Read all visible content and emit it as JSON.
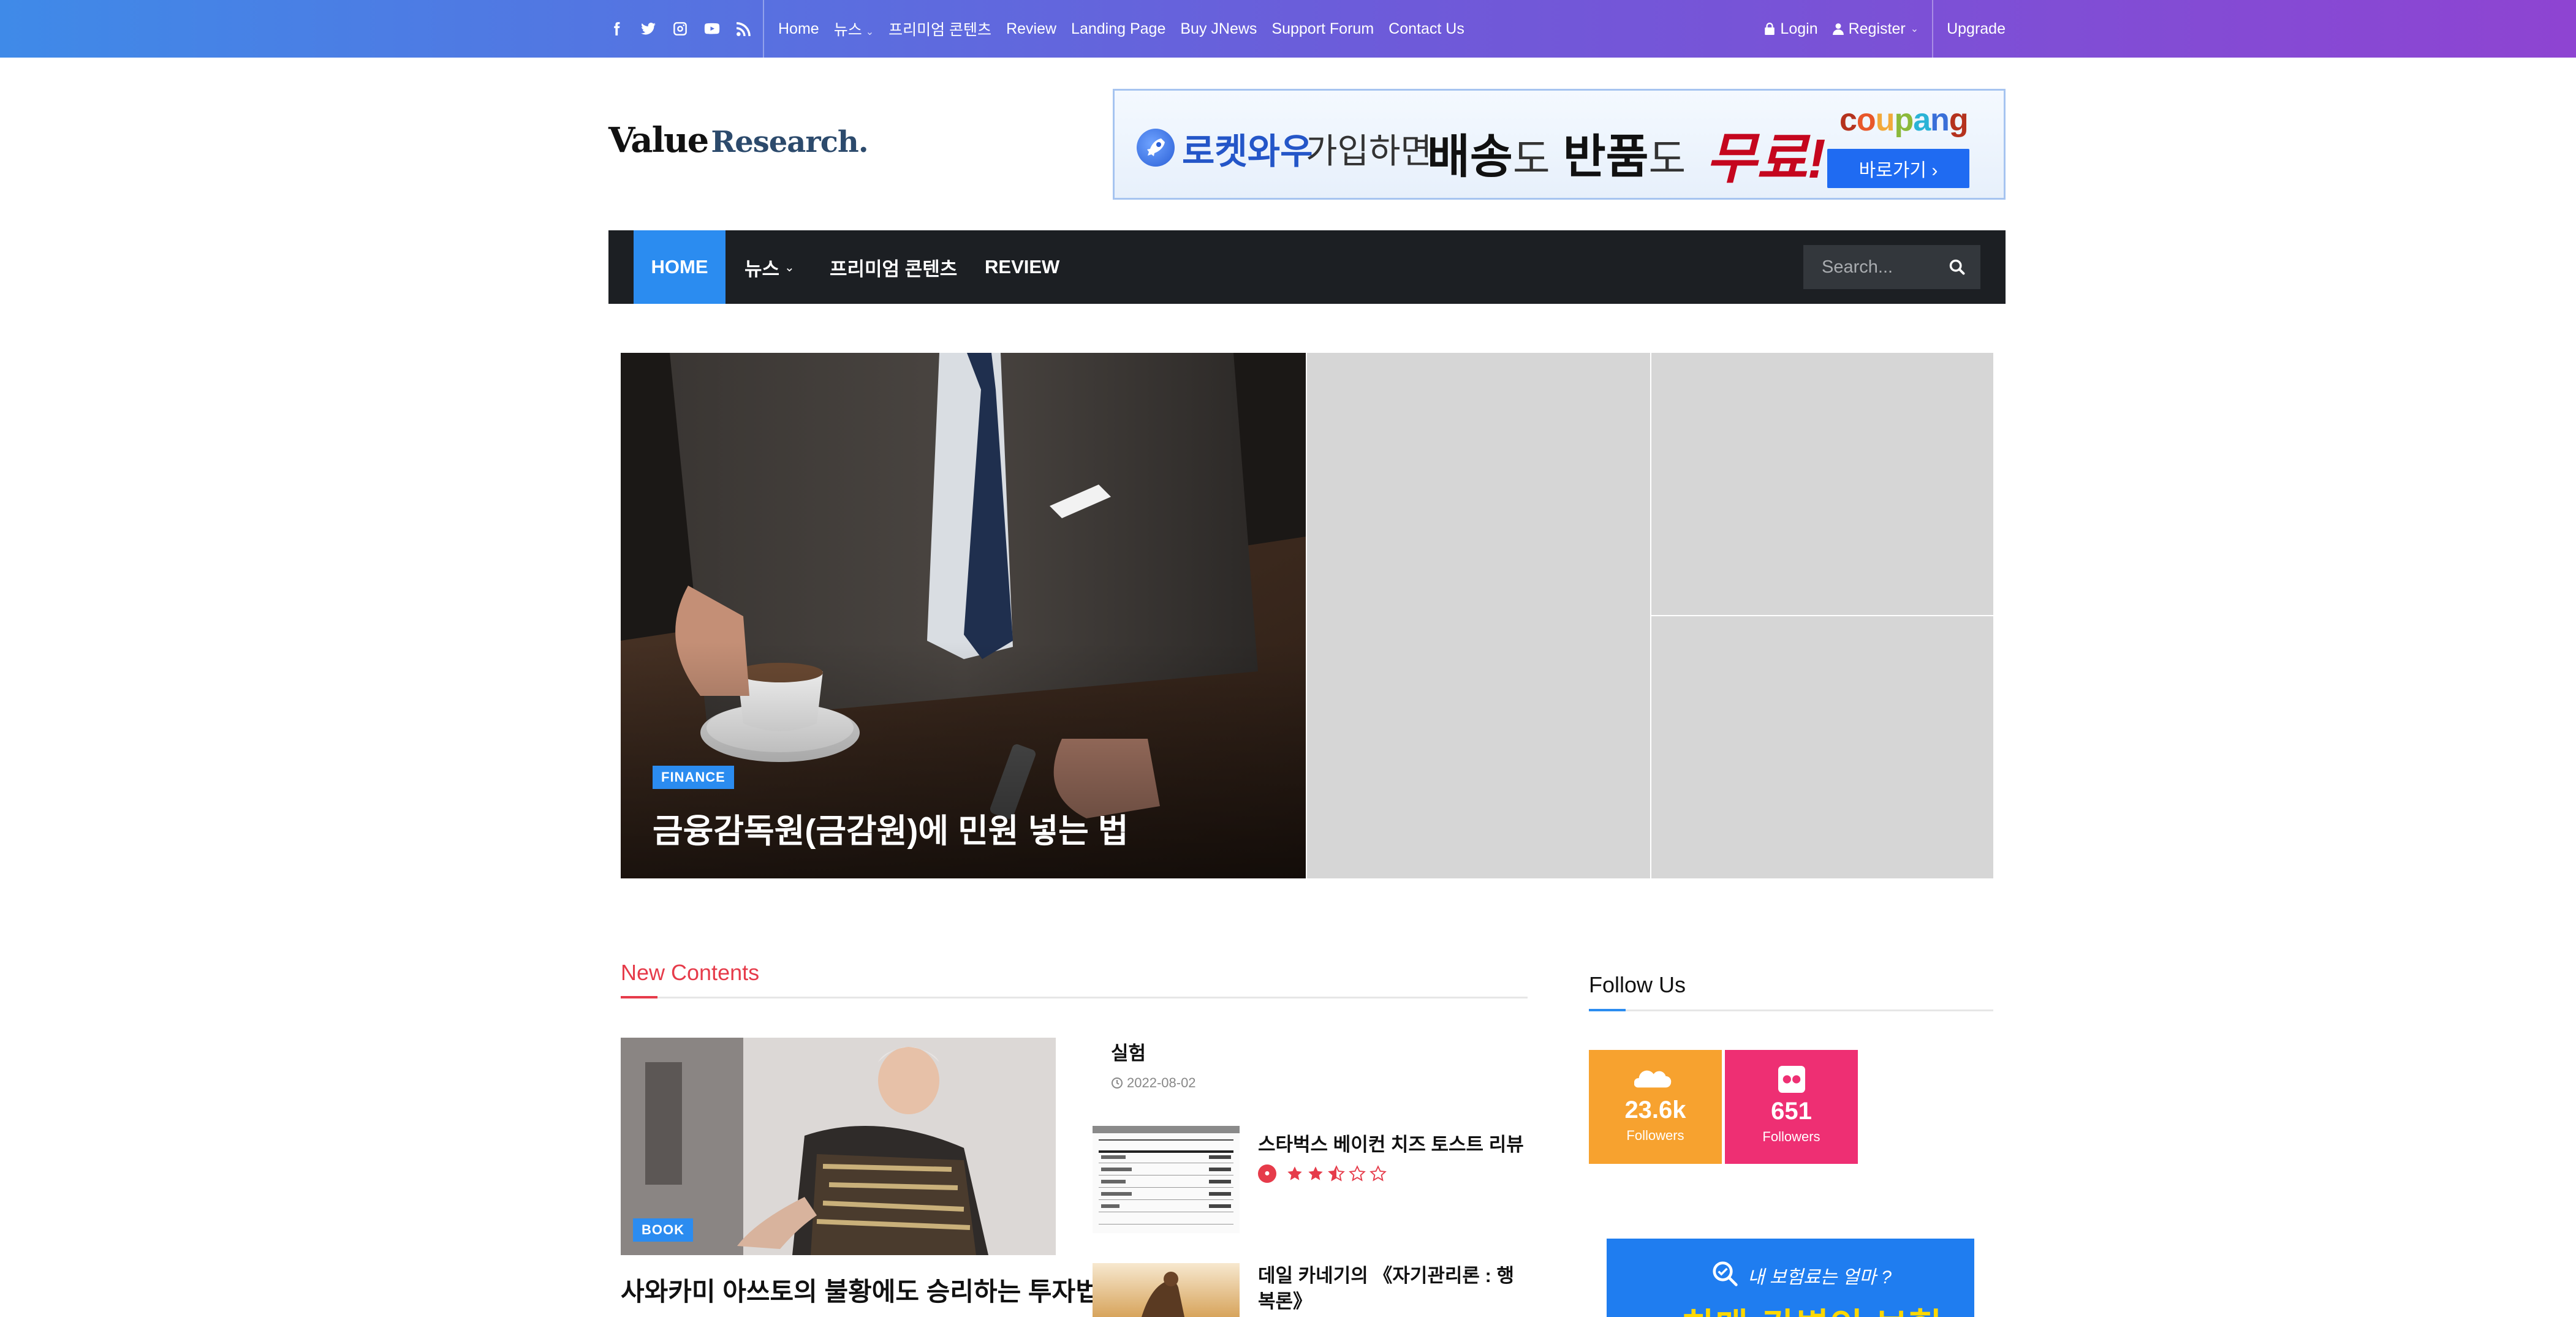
{
  "topbar": {
    "social": [
      "facebook-icon",
      "twitter-icon",
      "instagram-icon",
      "youtube-icon",
      "rss-icon"
    ],
    "nav": [
      "Home",
      "뉴스",
      "프리미엄 콘텐츠",
      "Review",
      "Landing Page",
      "Buy JNews",
      "Support Forum",
      "Contact Us"
    ],
    "login": "Login",
    "register": "Register",
    "upgrade": "Upgrade"
  },
  "header": {
    "logo_word1": "Value",
    "logo_word2": "Research."
  },
  "ad_banner": {
    "part1": "로켓와우",
    "part2": "가입하면",
    "part3a": "배송",
    "part3b": "도",
    "part3c": "반품",
    "part3d": "도",
    "part4": "무료!",
    "brand": [
      "c",
      "o",
      "u",
      "p",
      "a",
      "n",
      "g"
    ],
    "button": "바로가기 ›"
  },
  "mainnav": {
    "home": "HOME",
    "news": "뉴스",
    "premium": "프리미엄 콘텐츠",
    "review": "REVIEW",
    "search_placeholder": "Search..."
  },
  "hero": {
    "category": "FINANCE",
    "title": "금융감독원(금감원)에 민원 넣는 법"
  },
  "new_contents": {
    "section_title": "New Contents",
    "featured": {
      "category": "BOOK",
      "title": "사와카미 아쓰토의 불황에도 승리하는 투자법"
    },
    "list": [
      {
        "title": "실험",
        "date": "2022-08-02"
      },
      {
        "title": "스타벅스 베이컨 치즈 토스트 리뷰",
        "rating": 2.5
      },
      {
        "title": "데일 카네기의 《자기관리론 : 행복론》"
      }
    ]
  },
  "sidebar": {
    "follow_title": "Follow Us",
    "soundcloud": {
      "count": "23.6k",
      "label": "Followers"
    },
    "flickr": {
      "count": "651",
      "label": "Followers"
    },
    "ad_text1": "내 보험료는 얼마 ?",
    "ad_text2": "치매·간병인 보험"
  },
  "colors": {
    "accent_blue": "#2b8cf0",
    "accent_red": "#e63b4a",
    "soundcloud": "#f7a22f",
    "flickr": "#ee2f73",
    "nav_dark": "#1c1f23"
  }
}
